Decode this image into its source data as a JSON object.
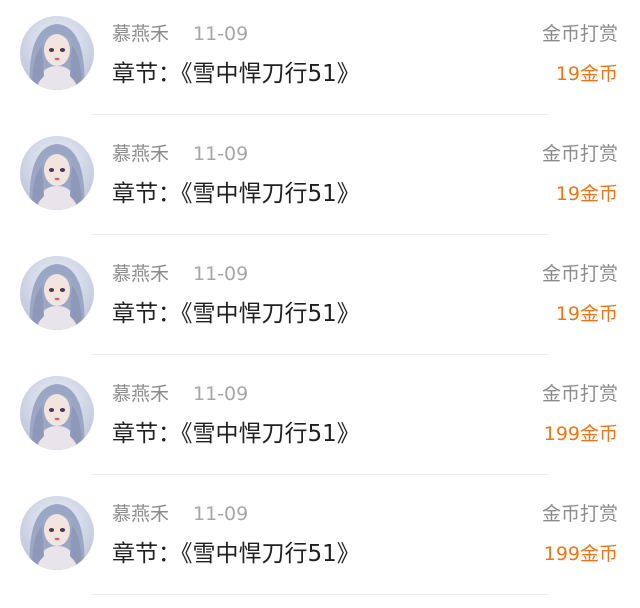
{
  "colors": {
    "meta_text": "#8c8c8c",
    "date_text": "#a6a6a6",
    "title_text": "#1f1f1f",
    "amount_text": "#e6781e",
    "divider": "#ededed"
  },
  "avatar_icon": "user-avatar-icon",
  "records": [
    {
      "user": "慕燕禾",
      "date": "11-09",
      "chapter": "章节：《雪中悍刀行51》",
      "gift_label": "金币打赏",
      "amount": "19金币"
    },
    {
      "user": "慕燕禾",
      "date": "11-09",
      "chapter": "章节：《雪中悍刀行51》",
      "gift_label": "金币打赏",
      "amount": "19金币"
    },
    {
      "user": "慕燕禾",
      "date": "11-09",
      "chapter": "章节：《雪中悍刀行51》",
      "gift_label": "金币打赏",
      "amount": "19金币"
    },
    {
      "user": "慕燕禾",
      "date": "11-09",
      "chapter": "章节：《雪中悍刀行51》",
      "gift_label": "金币打赏",
      "amount": "199金币"
    },
    {
      "user": "慕燕禾",
      "date": "11-09",
      "chapter": "章节：《雪中悍刀行51》",
      "gift_label": "金币打赏",
      "amount": "199金币"
    }
  ]
}
